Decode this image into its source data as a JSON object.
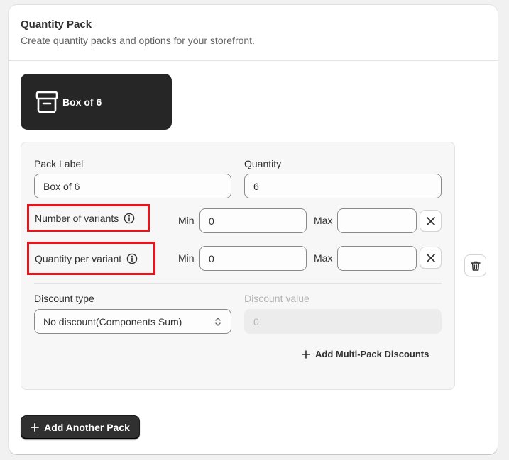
{
  "header": {
    "title": "Quantity Pack",
    "subtitle": "Create quantity packs and options for your storefront."
  },
  "pack_tile": {
    "label": "Box of 6",
    "icon": "box-icon"
  },
  "form": {
    "pack_label": {
      "label": "Pack Label",
      "value": "Box of 6"
    },
    "quantity": {
      "label": "Quantity",
      "value": "6"
    },
    "variants": {
      "label": "Number of variants",
      "min_label": "Min",
      "min_value": "0",
      "max_label": "Max",
      "max_value": ""
    },
    "per_variant": {
      "label": "Quantity per variant",
      "min_label": "Min",
      "min_value": "0",
      "max_label": "Max",
      "max_value": ""
    },
    "discount_type": {
      "label": "Discount type",
      "value": "No discount(Components Sum)"
    },
    "discount_value": {
      "label": "Discount value",
      "value": "0"
    },
    "add_discounts_label": "Add Multi-Pack Discounts"
  },
  "actions": {
    "add_pack_label": "Add Another Pack"
  },
  "colors": {
    "highlight": "#e8141b",
    "tile_bg": "#262626",
    "primary_button": "#303030"
  }
}
